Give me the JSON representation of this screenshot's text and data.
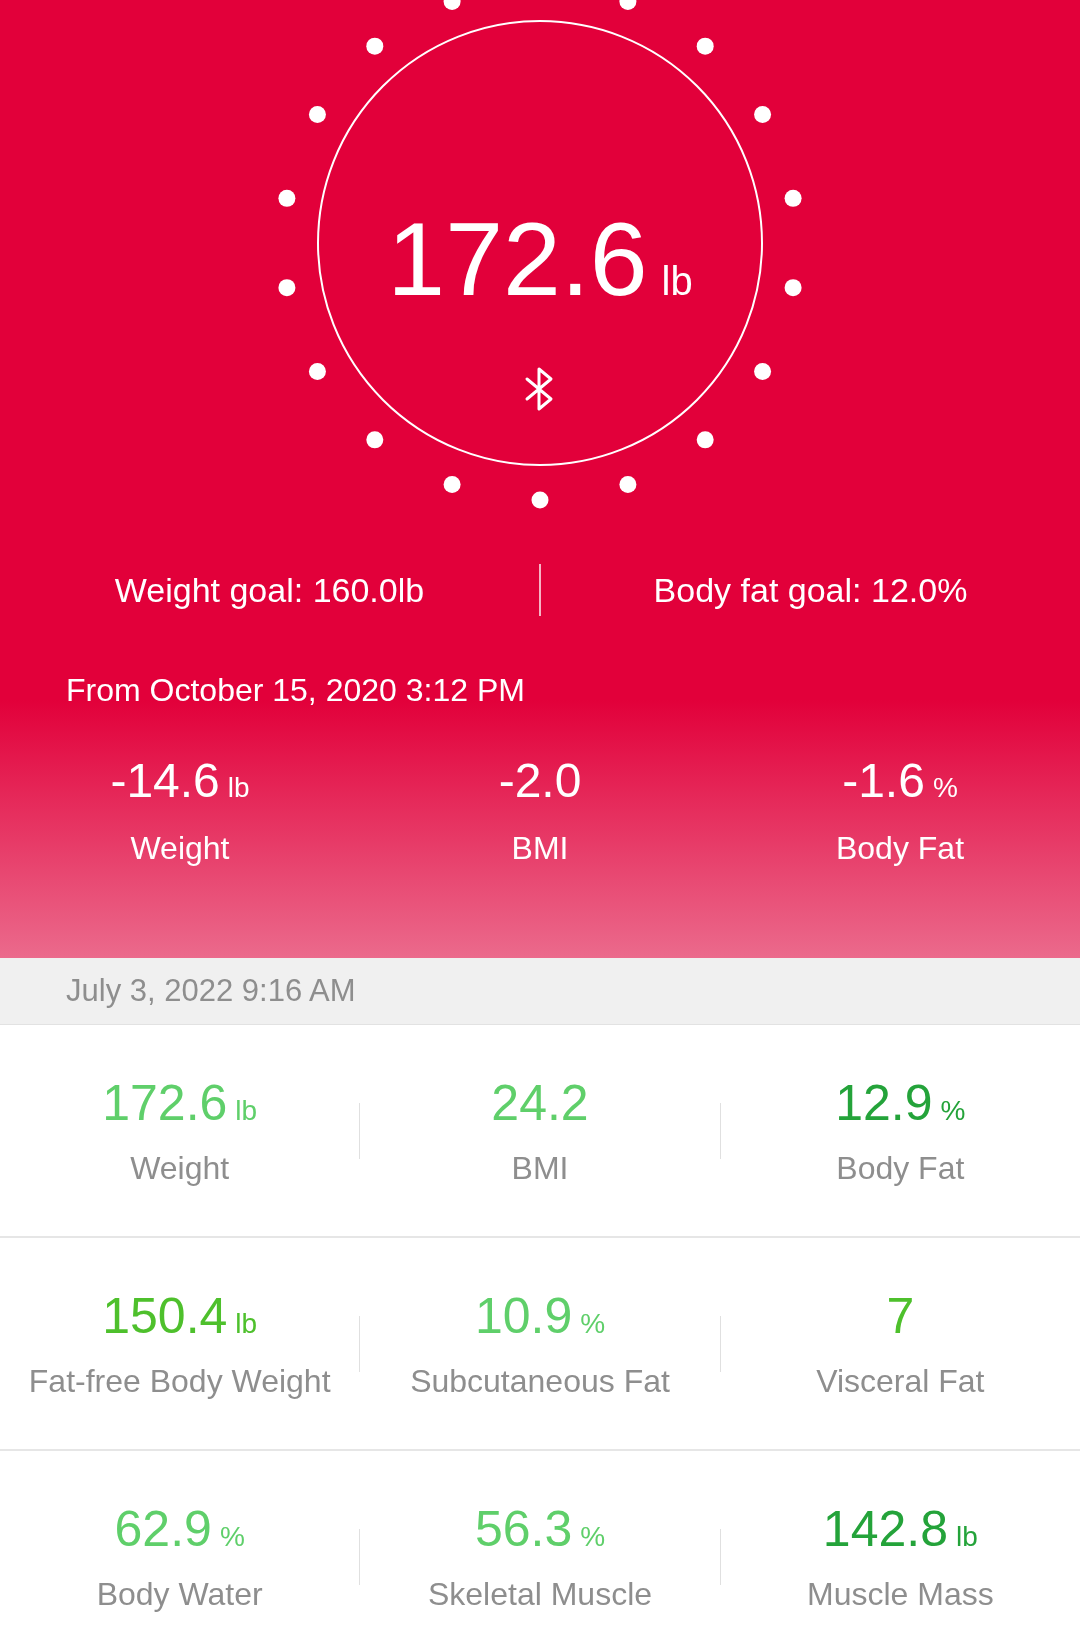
{
  "scale": {
    "weight": "172.6",
    "unit": "lb"
  },
  "goals": [
    "Weight goal: 160.0lb",
    "Body fat goal: 12.0%"
  ],
  "since": "From October 15, 2020 3:12 PM",
  "changes": [
    {
      "value": "-14.6",
      "unit": "lb",
      "label": "Weight"
    },
    {
      "value": "-2.0",
      "label": "BMI"
    },
    {
      "value": "-1.6",
      "unit": "%",
      "label": "Body Fat"
    }
  ],
  "measurement": {
    "date": "July 3, 2022 9:16 AM",
    "rows": [
      {
        "metrics": [
          {
            "value": "172.6",
            "unit": "lb",
            "label": "Weight",
            "color": "#5fcf6a"
          },
          {
            "value": "24.2",
            "label": "BMI",
            "color": "#5fcf6a"
          },
          {
            "value": "12.9",
            "unit": "%",
            "label": "Body Fat",
            "color": "#24a33a"
          }
        ]
      },
      {
        "metrics": [
          {
            "value": "150.4",
            "unit": "lb",
            "label": "Fat-free Body Weight",
            "color": "#4ec02c"
          },
          {
            "value": "10.9",
            "unit": "%",
            "label": "Subcutaneous Fat",
            "color": "#5fcf6a"
          },
          {
            "value": "7",
            "label": "Visceral Fat",
            "color": "#4ec02c"
          }
        ]
      },
      {
        "metrics": [
          {
            "value": "62.9",
            "unit": "%",
            "label": "Body Water",
            "color": "#5fcf6a"
          },
          {
            "value": "56.3",
            "unit": "%",
            "label": "Skeletal Muscle",
            "color": "#5fcf6a"
          },
          {
            "value": "142.8",
            "unit": "lb",
            "label": "Muscle Mass",
            "color": "#24a33a"
          }
        ]
      }
    ]
  }
}
